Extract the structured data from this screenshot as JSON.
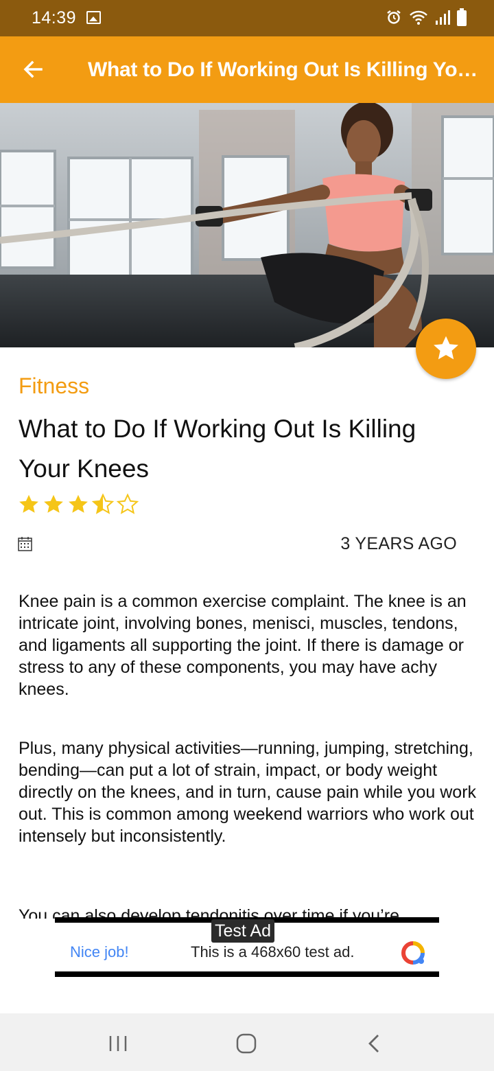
{
  "status_bar": {
    "time": "14:39",
    "icons": [
      "image-icon",
      "alarm-icon",
      "wifi-icon",
      "signal-icon",
      "battery-icon"
    ]
  },
  "app_bar": {
    "title": "What to Do If Working Out Is Killing Your Knees",
    "back_icon": "arrow-left-icon",
    "background": "#F39C12"
  },
  "hero": {
    "image_description_icon": "photo",
    "fab_icon": "star-icon"
  },
  "article": {
    "category": "Fitness",
    "title": "What to Do If Working Out Is Killing Your Knees",
    "rating": 3.5,
    "rating_max": 5,
    "date": "3 YEARS AGO",
    "paragraphs": [
      "Knee pain is a common exercise complaint. The knee is an intricate joint, involving bones, menisci, muscles, tendons, and ligaments all supporting the joint. If there is damage or stress to any of these components, you may have achy knees.",
      "Plus, many physical activities—running, jumping, stretching, bending—can put a lot of strain, impact, or body weight directly on the knees, and in turn, cause pain while you work out. This is common among weekend warriors who work out intensely but inconsistently.",
      "You can also develop tendonitis over time if you’re"
    ]
  },
  "ad": {
    "label": "Test Ad",
    "link": "Nice job!",
    "text": "This is a 468x60 test ad."
  },
  "nav_bar": {
    "buttons": [
      "recent-apps-icon",
      "home-icon",
      "back-icon"
    ]
  },
  "colors": {
    "accent": "#F39C12",
    "status_bar": "#8B5A0E",
    "star": "#F5C518",
    "ad_link": "#4285F4"
  }
}
